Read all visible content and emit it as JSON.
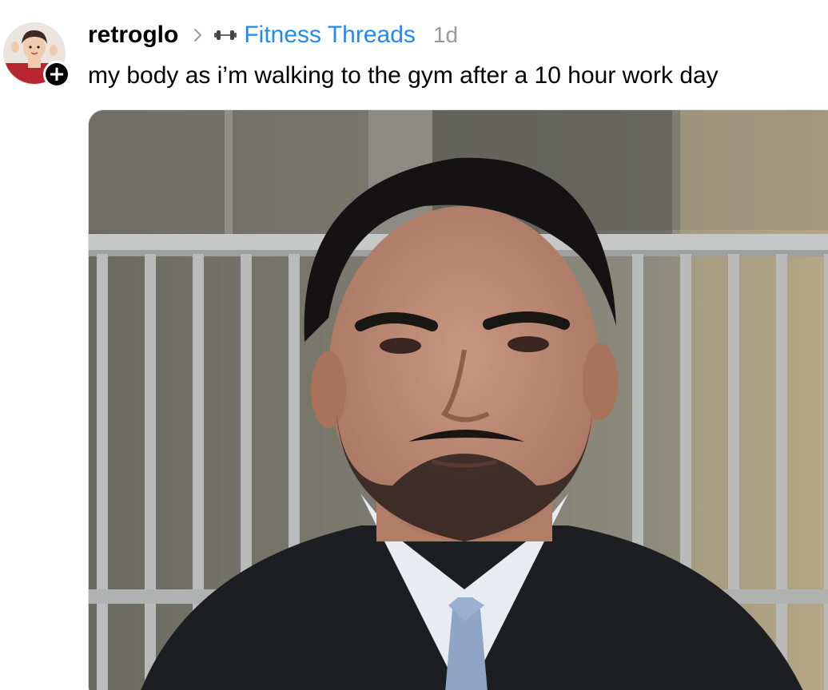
{
  "post": {
    "author": {
      "username": "retroglo",
      "avatar_icon": "user-avatar",
      "follow_icon": "plus-icon"
    },
    "community": {
      "icon": "dumbbell-icon",
      "name": "Fitness Threads"
    },
    "separator_icon": "chevron-right-icon",
    "timestamp": "1d",
    "text": "my body as i’m walking to the gym after a 10 hour work day",
    "media": {
      "type": "photo"
    },
    "colors": {
      "community_link": "#1f8af2",
      "timestamp": "#999999",
      "text": "#000000"
    }
  }
}
